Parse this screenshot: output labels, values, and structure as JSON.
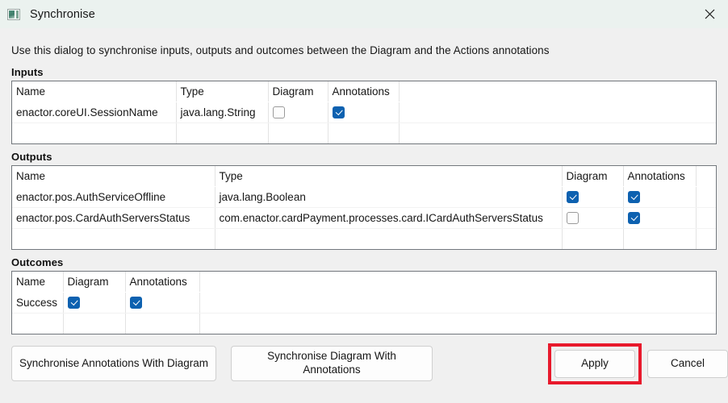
{
  "window": {
    "title": "Synchronise",
    "icon": "application-icon",
    "close_label": "close-icon"
  },
  "description": "Use this dialog to synchronise inputs, outputs and outcomes between the Diagram and the Actions annotations",
  "sections": {
    "inputs": {
      "label": "Inputs",
      "columns": [
        "Name",
        "Type",
        "Diagram",
        "Annotations",
        ""
      ],
      "rows": [
        {
          "name": "enactor.coreUI.SessionName",
          "type": "java.lang.String",
          "diagram": false,
          "annotations": true
        }
      ]
    },
    "outputs": {
      "label": "Outputs",
      "columns": [
        "Name",
        "Type",
        "Diagram",
        "Annotations",
        ""
      ],
      "rows": [
        {
          "name": "enactor.pos.AuthServiceOffline",
          "type": "java.lang.Boolean",
          "diagram": true,
          "annotations": true
        },
        {
          "name": "enactor.pos.CardAuthServersStatus",
          "type": "com.enactor.cardPayment.processes.card.ICardAuthServersStatus",
          "diagram": false,
          "annotations": true
        }
      ]
    },
    "outcomes": {
      "label": "Outcomes",
      "columns": [
        "Name",
        "Diagram",
        "Annotations",
        ""
      ],
      "rows": [
        {
          "name": "Success",
          "diagram": true,
          "annotations": true
        }
      ]
    }
  },
  "footer": {
    "sync_annotations_with_diagram": "Synchronise Annotations With Diagram",
    "sync_diagram_with_annotations": "Synchronise Diagram With Annotations",
    "apply": "Apply",
    "cancel": "Cancel"
  },
  "colors": {
    "titlebar": "#ebf2ef",
    "body": "#f0f0f0",
    "checkbox_on": "#0d61b0",
    "highlight": "#e8192c",
    "table_border": "#72777d"
  }
}
